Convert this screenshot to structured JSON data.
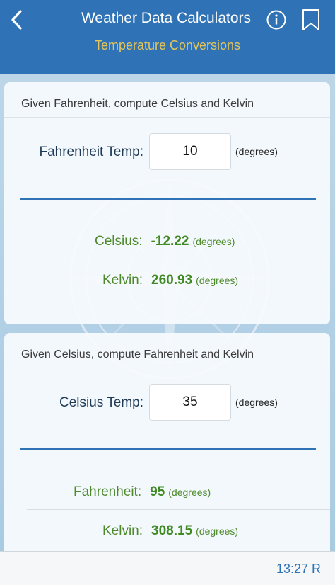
{
  "nav": {
    "title": "Weather Data Calculators",
    "subtitle": "Temperature Conversions",
    "icons": {
      "back": "chevron-left-icon",
      "info": "info-circle-icon",
      "bookmark": "bookmark-icon"
    }
  },
  "f_to_c": {
    "header": "Given Fahrenheit, compute Celsius and Kelvin",
    "input_label": "Fahrenheit Temp:",
    "input_value": "10",
    "input_unit": "(degrees)",
    "results": [
      {
        "label": "Celsius:",
        "value": "-12.22",
        "unit": "(degrees)"
      },
      {
        "label": "Kelvin:",
        "value": "260.93",
        "unit": "(degrees)"
      }
    ]
  },
  "c_to_f": {
    "header": "Given Celsius, compute Fahrenheit and Kelvin",
    "input_label": "Celsius Temp:",
    "input_value": "35",
    "input_unit": "(degrees)",
    "results": [
      {
        "label": "Fahrenheit:",
        "value": "95",
        "unit": "(degrees)"
      },
      {
        "label": "Kelvin:",
        "value": "308.15",
        "unit": "(degrees)"
      }
    ]
  },
  "footer": {
    "clock_text": "13:27 R"
  },
  "colors": {
    "nav_bg": "#2f73b6",
    "subtitle": "#e5c55a",
    "result_green": "#3f8a23",
    "divider_blue": "#2f73b6"
  }
}
